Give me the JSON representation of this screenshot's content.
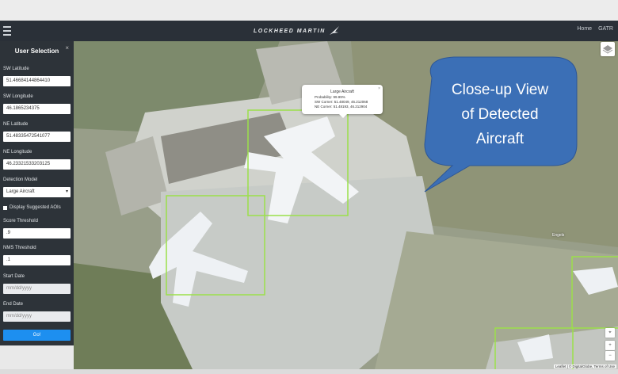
{
  "nav": {
    "brand": "LOCKHEED MARTIN",
    "links": [
      "Home",
      "GATR"
    ]
  },
  "sidebar": {
    "title": "User Selection",
    "sw_lat_label": "SW Latitude",
    "sw_lat_value": "51.46684144864410",
    "sw_lon_label": "SW Longitude",
    "sw_lon_value": "46.1865234375",
    "ne_lat_label": "NE Latitude",
    "ne_lat_value": "51.48335472541077",
    "ne_lon_label": "NE Longitude",
    "ne_lon_value": "46.23321533203125",
    "model_label": "Detection Model",
    "model_value": "Large Aircraft",
    "suggested_label": "Display Suggested AOIs",
    "score_label": "Score Threshold",
    "score_value": ".9",
    "nms_label": "NMS Threshold",
    "nms_value": ".1",
    "start_label": "Start Date",
    "start_placeholder": "mm/dd/yyyy",
    "end_label": "End Date",
    "end_placeholder": "mm/dd/yyyy",
    "go_label": "Go!"
  },
  "popup": {
    "title": "Large Aircraft",
    "probability": "Probability: 99.99%",
    "sw_corner": "SW Corner: 51.48049, 46.212068",
    "ne_corner": "NE Corner: 51.48193, 46.212904"
  },
  "callout": {
    "lines": [
      "Close-up View",
      "of Detected",
      "Aircraft"
    ]
  },
  "map": {
    "place_label": "Engels",
    "attribution": "Leaflet | © DigitalGlobe, Terms of Use"
  },
  "colors": {
    "navbar": "#2a3038",
    "sidebar": "#2d3339",
    "go_button": "#1d8ff0",
    "detection_box": "#9be04a",
    "callout": "#3b6fb6"
  }
}
